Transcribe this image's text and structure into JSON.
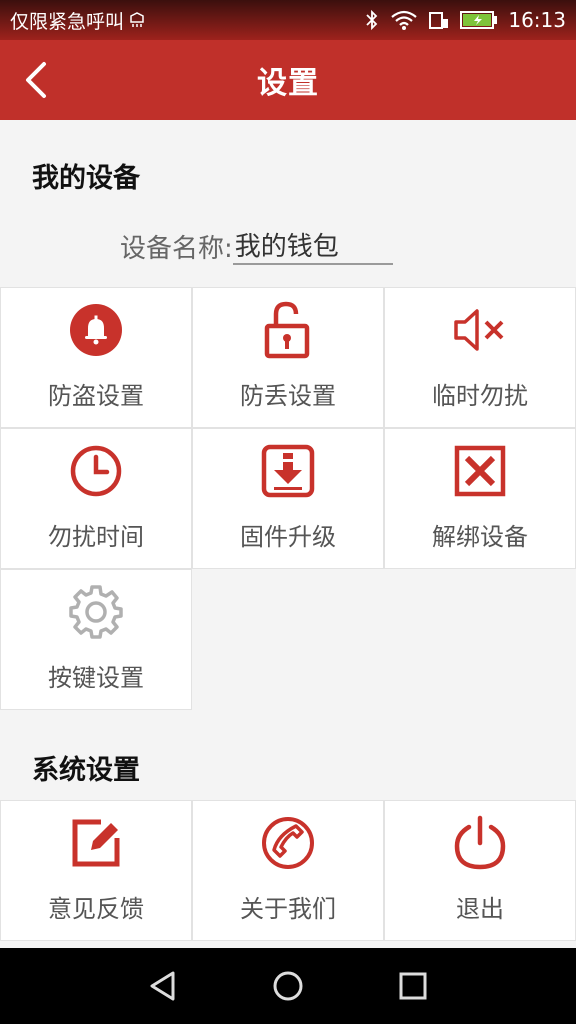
{
  "status_bar": {
    "carrier": "仅限紧急呼叫",
    "time": "16:13"
  },
  "header": {
    "title": "设置",
    "back_icon": "chevron-left-icon"
  },
  "my_device": {
    "section_title": "我的设备",
    "device_name_label": "设备名称:",
    "device_name_value": "我的钱包",
    "items": [
      {
        "label": "防盗设置",
        "icon": "bell-icon"
      },
      {
        "label": "防丢设置",
        "icon": "unlock-icon"
      },
      {
        "label": "临时勿扰",
        "icon": "mute-icon"
      },
      {
        "label": "勿扰时间",
        "icon": "clock-icon"
      },
      {
        "label": "固件升级",
        "icon": "download-icon"
      },
      {
        "label": "解绑设备",
        "icon": "close-box-icon"
      },
      {
        "label": "按键设置",
        "icon": "gear-icon"
      }
    ]
  },
  "system": {
    "section_title": "系统设置",
    "items": [
      {
        "label": "意见反馈",
        "icon": "edit-icon"
      },
      {
        "label": "关于我们",
        "icon": "phone-icon"
      },
      {
        "label": "退出",
        "icon": "power-icon"
      }
    ]
  },
  "colors": {
    "brand": "#c0302a",
    "icon_red": "#c8322b",
    "icon_gray": "#b0b0b0"
  },
  "nav_bar": {
    "buttons": [
      "back-triangle-icon",
      "home-circle-icon",
      "recents-square-icon"
    ]
  }
}
